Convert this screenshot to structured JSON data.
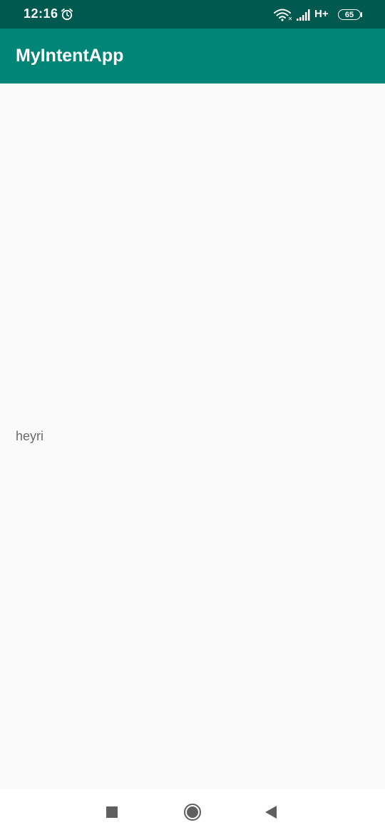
{
  "status_bar": {
    "time": "12:16",
    "network_type": "H+",
    "battery_level": "65",
    "icons": [
      "alarm-icon",
      "wifi-icon",
      "signal-icon",
      "battery-icon"
    ]
  },
  "app_bar": {
    "title": "MyIntentApp"
  },
  "content": {
    "message": "heyri"
  },
  "nav_bar": {
    "buttons": [
      "recents-icon",
      "home-icon",
      "back-icon"
    ]
  },
  "colors": {
    "status_bar": "#00594f",
    "app_bar": "#008577",
    "background": "#fafafa",
    "text": "#6b6b6b",
    "nav_icons": "#5f5f5f"
  }
}
